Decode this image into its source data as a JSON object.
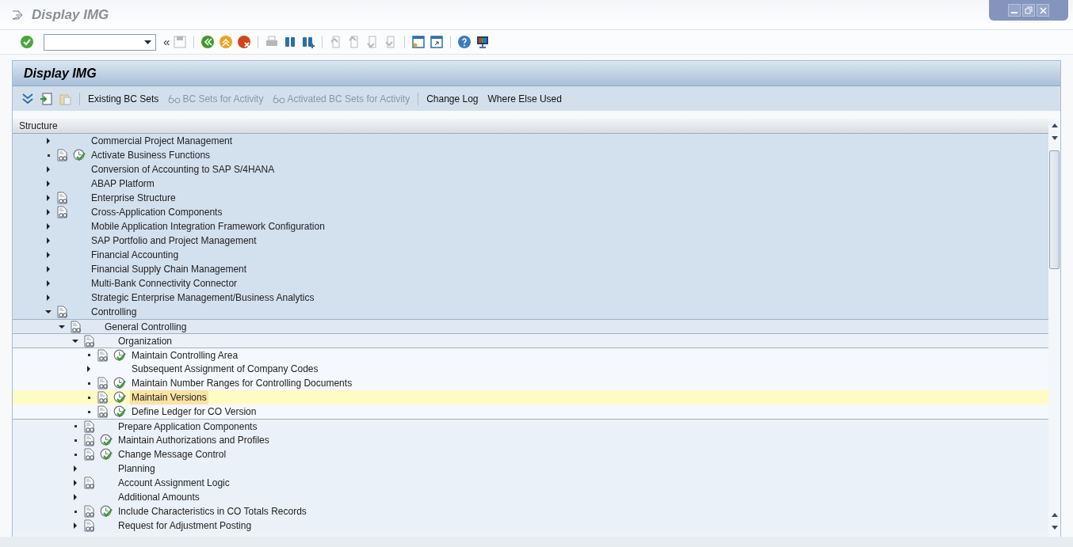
{
  "window": {
    "title": "Display IMG"
  },
  "toolbar": {
    "collapse_label": "«"
  },
  "panel": {
    "title": "Display IMG",
    "button_groups": [
      [
        {
          "label": "Existing BC Sets",
          "kind": "text",
          "disabled": false
        },
        {
          "label": "BC Sets for Activity",
          "kind": "icon-text",
          "disabled": true
        },
        {
          "label": "Activated BC Sets for Activity",
          "kind": "icon-text",
          "disabled": true
        }
      ],
      [
        {
          "label": "Change Log",
          "kind": "text",
          "disabled": false
        },
        {
          "label": "Where Else Used",
          "kind": "text",
          "disabled": false
        }
      ]
    ]
  },
  "tree": {
    "header": "Structure",
    "nodes": [
      {
        "label": "Commercial Project Management",
        "kind": "folder",
        "expanded": false,
        "documentation": false,
        "activity": false,
        "selected": false
      },
      {
        "label": "Activate Business Functions",
        "kind": "leaf",
        "documentation": true,
        "activity": true,
        "selected": false
      },
      {
        "label": "Conversion of Accounting to SAP S/4HANA",
        "kind": "folder",
        "expanded": false,
        "documentation": false,
        "activity": false,
        "selected": false
      },
      {
        "label": "ABAP Platform",
        "kind": "folder",
        "expanded": false,
        "documentation": false,
        "activity": false,
        "selected": false
      },
      {
        "label": "Enterprise Structure",
        "kind": "folder",
        "expanded": false,
        "documentation": true,
        "activity": false,
        "selected": false
      },
      {
        "label": "Cross-Application Components",
        "kind": "folder",
        "expanded": false,
        "documentation": true,
        "activity": false,
        "selected": false
      },
      {
        "label": "Mobile Application Integration Framework Configuration",
        "kind": "folder",
        "expanded": false,
        "documentation": false,
        "activity": false,
        "selected": false
      },
      {
        "label": "SAP Portfolio and Project Management",
        "kind": "folder",
        "expanded": false,
        "documentation": false,
        "activity": false,
        "selected": false
      },
      {
        "label": "Financial Accounting",
        "kind": "folder",
        "expanded": false,
        "documentation": false,
        "activity": false,
        "selected": false
      },
      {
        "label": "Financial Supply Chain Management",
        "kind": "folder",
        "expanded": false,
        "documentation": false,
        "activity": false,
        "selected": false
      },
      {
        "label": "Multi-Bank Connectivity Connector",
        "kind": "folder",
        "expanded": false,
        "documentation": false,
        "activity": false,
        "selected": false
      },
      {
        "label": "Strategic Enterprise Management/Business Analytics",
        "kind": "folder",
        "expanded": false,
        "documentation": false,
        "activity": false,
        "selected": false
      },
      {
        "label": "Controlling",
        "kind": "folder",
        "expanded": true,
        "documentation": true,
        "activity": false,
        "selected": false,
        "children": [
          {
            "label": "General Controlling",
            "kind": "folder",
            "expanded": true,
            "documentation": true,
            "activity": false,
            "selected": false,
            "children": [
              {
                "label": "Organization",
                "kind": "folder",
                "expanded": true,
                "documentation": true,
                "activity": false,
                "selected": false,
                "children": [
                  {
                    "label": "Maintain Controlling Area",
                    "kind": "leaf",
                    "documentation": true,
                    "activity": true,
                    "selected": false
                  },
                  {
                    "label": "Subsequent Assignment of Company Codes",
                    "kind": "folder",
                    "expanded": false,
                    "documentation": false,
                    "activity": false,
                    "selected": false
                  },
                  {
                    "label": "Maintain Number Ranges for Controlling Documents",
                    "kind": "leaf",
                    "documentation": true,
                    "activity": true,
                    "selected": false
                  },
                  {
                    "label": "Maintain Versions",
                    "kind": "leaf",
                    "documentation": true,
                    "activity": true,
                    "selected": true
                  },
                  {
                    "label": "Define Ledger for CO Version",
                    "kind": "leaf",
                    "documentation": true,
                    "activity": true,
                    "selected": false
                  }
                ]
              },
              {
                "label": "Prepare Application Components",
                "kind": "leaf",
                "documentation": true,
                "activity": false,
                "selected": false
              },
              {
                "label": "Maintain Authorizations and Profiles",
                "kind": "leaf",
                "documentation": true,
                "activity": true,
                "selected": false
              },
              {
                "label": "Change Message Control",
                "kind": "leaf",
                "documentation": true,
                "activity": true,
                "selected": false
              },
              {
                "label": "Planning",
                "kind": "folder",
                "expanded": false,
                "documentation": false,
                "activity": false,
                "selected": false
              },
              {
                "label": "Account Assignment Logic",
                "kind": "folder",
                "expanded": false,
                "documentation": true,
                "activity": false,
                "selected": false
              },
              {
                "label": "Additional Amounts",
                "kind": "folder",
                "expanded": false,
                "documentation": false,
                "activity": false,
                "selected": false
              },
              {
                "label": "Include Characteristics in CO Totals Records",
                "kind": "leaf",
                "documentation": true,
                "activity": true,
                "selected": false
              },
              {
                "label": "Request for Adjustment Posting",
                "kind": "folder",
                "expanded": false,
                "documentation": true,
                "activity": false,
                "selected": false
              }
            ]
          }
        ]
      }
    ]
  }
}
